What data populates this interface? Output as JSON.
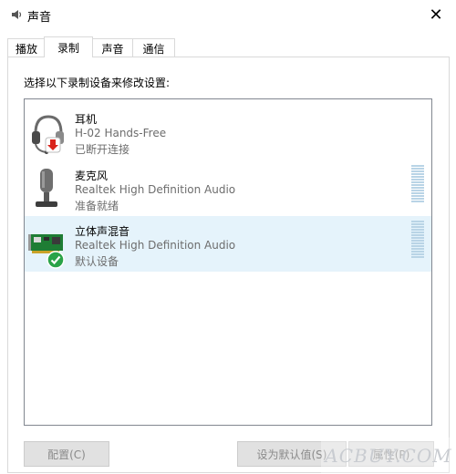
{
  "window": {
    "title": "声音",
    "close_glyph": "✕"
  },
  "tabs": [
    {
      "label": "播放"
    },
    {
      "label": "录制",
      "active": true
    },
    {
      "label": "声音"
    },
    {
      "label": "通信"
    }
  ],
  "panel": {
    "instruction": "选择以下录制设备来修改设置:"
  },
  "devices": [
    {
      "name": "耳机",
      "driver": "H-02 Hands-Free",
      "status": "已断开连接",
      "icon": "headset-icon",
      "badge": "disconnected-badge-icon"
    },
    {
      "name": "麦克风",
      "driver": "Realtek High Definition Audio",
      "status": "准备就绪",
      "icon": "microphone-icon"
    },
    {
      "name": "立体声混音",
      "driver": "Realtek High Definition Audio",
      "status": "默认设备",
      "icon": "sound-card-icon",
      "badge": "default-check-badge-icon",
      "selected": true
    }
  ],
  "buttons": {
    "configure": "配置(C)",
    "set_default": "设为默认值(S)",
    "properties": "属性(P)"
  },
  "colors": {
    "selection": "#e5f3fb",
    "level_meter": "#b9d4e6",
    "disabled_button": "#e1e1e1",
    "default_badge": "#2aa348",
    "disconnected_badge": "#d9241c"
  }
}
